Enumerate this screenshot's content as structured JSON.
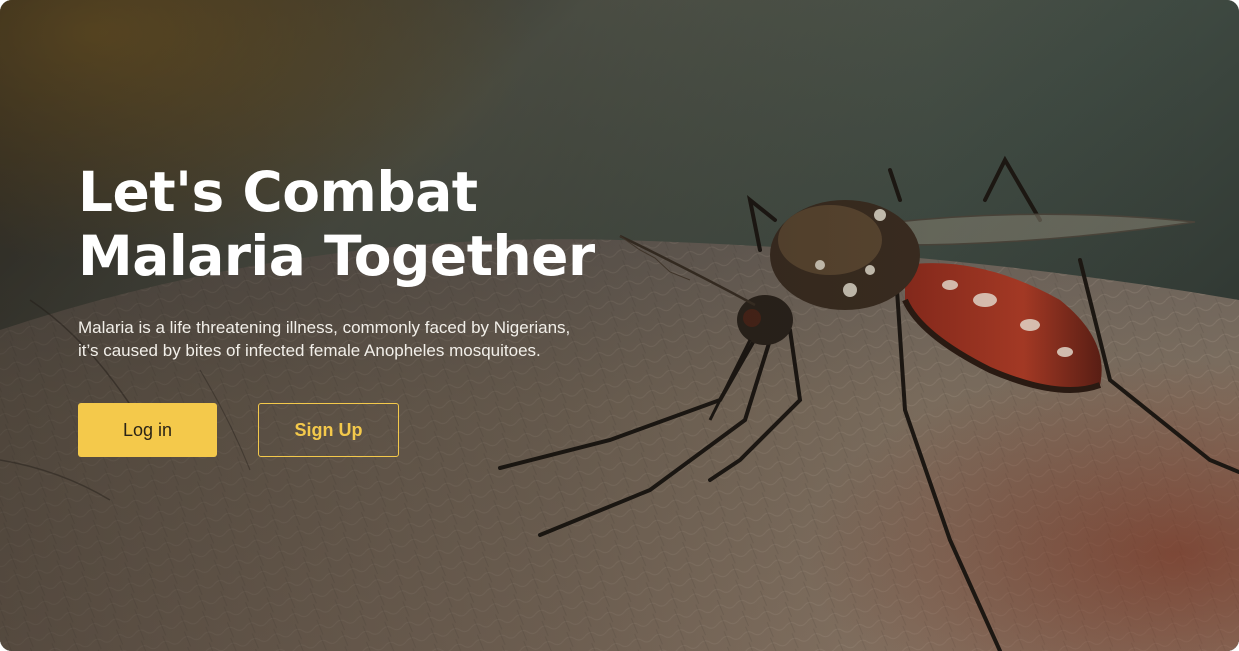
{
  "hero": {
    "title": "Let's Combat Malaria Together",
    "description_line1": "Malaria is a life threatening illness, commonly faced by Nigerians,",
    "description_line2": "it’s caused by  bites of infected female Anopheles mosquitoes."
  },
  "actions": {
    "login_label": "Log in",
    "signup_label": "Sign Up"
  },
  "colors": {
    "accent": "#f4c94b",
    "title_text": "#ffffff",
    "login_text": "#2a2416"
  },
  "image": {
    "subject": "mosquito-on-skin-photo"
  }
}
